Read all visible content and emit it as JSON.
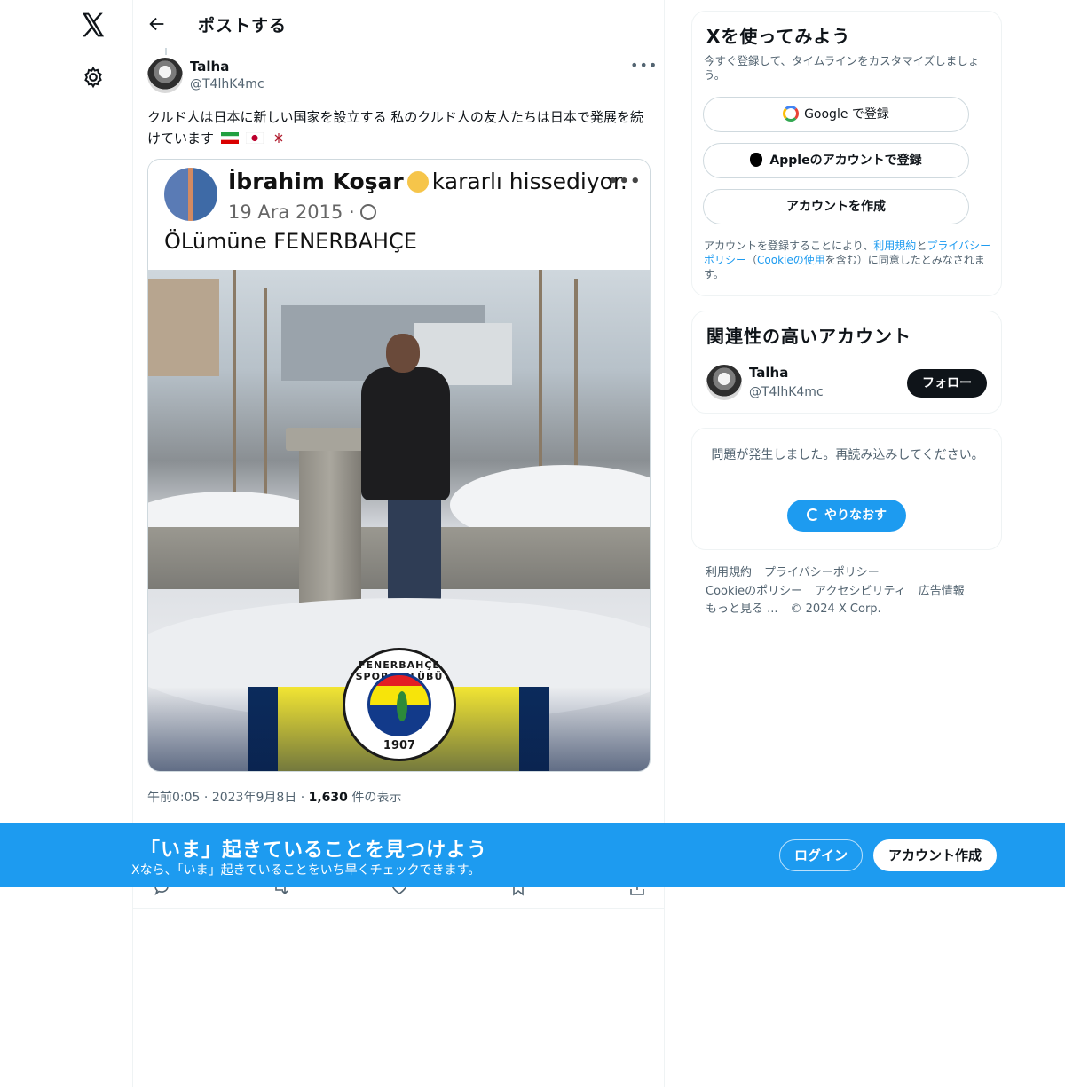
{
  "header": {
    "title": "ポストする"
  },
  "tweet": {
    "author_name": "Talha",
    "author_handle": "@T4lhK4mc",
    "more": "•••",
    "text": "クルド人は日本に新しい国家を設立する 私のクルド人の友人たちは日本で発展を続けています",
    "time": "午前0:05",
    "date": "2023年9月8日",
    "views_count": "1,630",
    "views_label": "件の表示"
  },
  "embedded_post": {
    "name": "İbrahim Koşar",
    "status": "kararlı hissediyor.",
    "date": "19 Ara 2015 ·",
    "text": "ÖLümüne FENERBAHÇE",
    "crest_top": "FENERBAHÇE SPOR KULÜBÜ",
    "crest_year": "1907"
  },
  "signup_card": {
    "title": "Xを使ってみよう",
    "subtitle": "今すぐ登録して、タイムラインをカスタマイズしましょう。",
    "google": "Google で登録",
    "apple": "Appleのアカウントで登録",
    "create": "アカウントを作成",
    "legal_1": "アカウントを登録することにより、",
    "legal_terms": "利用規約",
    "legal_2": "と",
    "legal_privacy": "プライバシーポリシー",
    "legal_3": "（",
    "legal_cookie": "Cookieの使用",
    "legal_4": "を含む）に同意したとみなされます。"
  },
  "related": {
    "title": "関連性の高いアカウント",
    "name": "Talha",
    "handle": "@T4lhK4mc",
    "follow": "フォロー"
  },
  "error_card": {
    "message": "問題が発生しました。再読み込みしてください。",
    "retry": "やりなおす"
  },
  "footer": {
    "terms": "利用規約",
    "privacy": "プライバシーポリシー",
    "cookie": "Cookieのポリシー",
    "accessibility": "アクセシビリティ",
    "ads": "広告情報",
    "more": "もっと見る ...",
    "copyright": "© 2024 X Corp."
  },
  "bottom_banner": {
    "title": "「いま」起きていることを見つけよう",
    "subtitle": "Xなら、「いま」起きていることをいち早くチェックできます。",
    "login": "ログイン",
    "signup": "アカウント作成"
  },
  "colors": {
    "accent": "#1d9bf0",
    "text": "#0f1419",
    "muted": "#536471"
  }
}
